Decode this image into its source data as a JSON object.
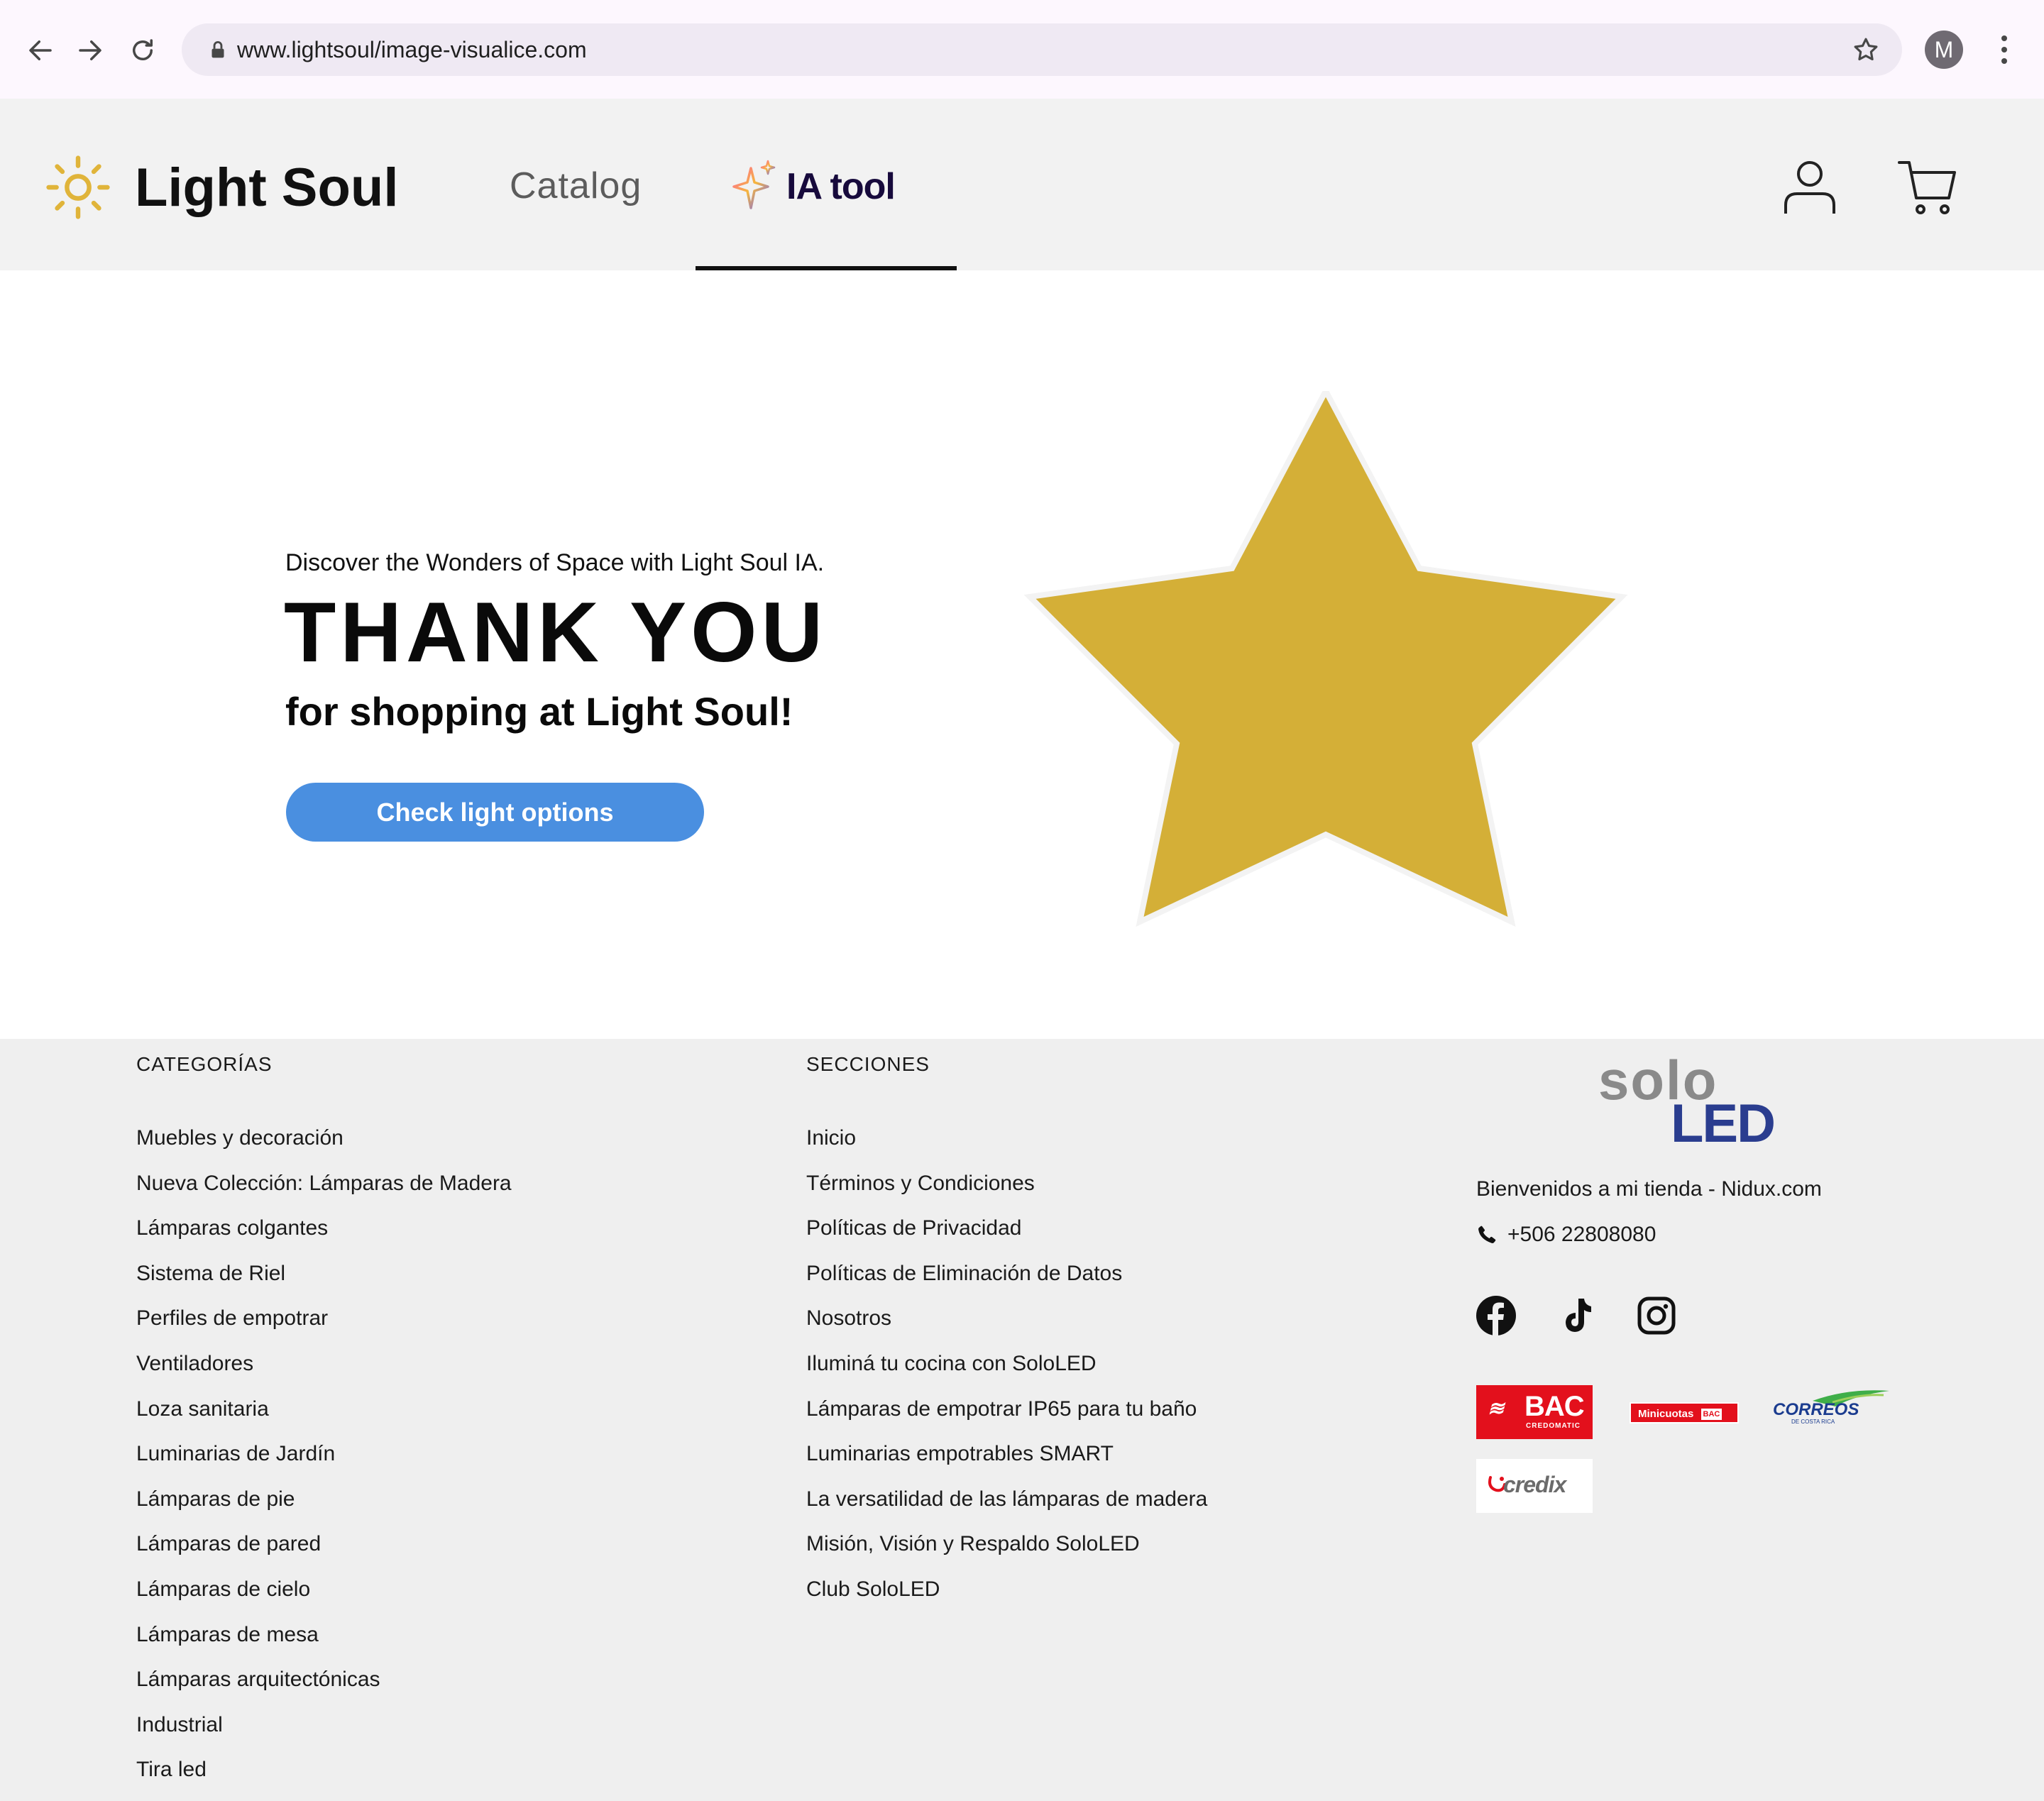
{
  "browser": {
    "url": "www.lightsoul/image-visualice.com",
    "profile_initial": "M"
  },
  "header": {
    "brand": "Light Soul",
    "nav": {
      "catalog": "Catalog",
      "ia_tool": "IA tool",
      "active": "ia_tool"
    }
  },
  "hero": {
    "kicker": "Discover the Wonders of Space with Light Soul IA.",
    "title": "THANK YOU",
    "subtitle": "for shopping at Light Soul!",
    "cta_label": "Check light options",
    "star_color": "#d4af37"
  },
  "footer": {
    "categories": {
      "heading": "CATEGORÍAS",
      "items": [
        "Muebles y decoración",
        "Nueva Colección: Lámparas de Madera",
        "Lámparas colgantes",
        "Sistema de Riel",
        "Perfiles de empotrar",
        "Ventiladores",
        "Loza sanitaria",
        "Luminarias de Jardín",
        "Lámparas de pie",
        "Lámparas de pared",
        "Lámparas de cielo",
        "Lámparas de mesa",
        "Lámparas arquitectónicas",
        "Industrial",
        "Tira led"
      ]
    },
    "sections": {
      "heading": "SECCIONES",
      "items": [
        "Inicio",
        "Términos y Condiciones",
        "Políticas de Privacidad",
        "Políticas de Eliminación de Datos",
        "Nosotros",
        "Iluminá tu cocina con SoloLED",
        "Lámparas de empotrar IP65 para tu baño",
        "Luminarias empotrables SMART",
        "La versatilidad de las lámparas de madera",
        "Misión, Visión y Respaldo SoloLED",
        "Club SoloLED"
      ]
    },
    "store": {
      "logo_top": "solo",
      "logo_bottom": "LED",
      "welcome": "Bienvenidos a mi tienda - Nidux.com",
      "phone": "+506 22808080",
      "social": [
        "facebook-icon",
        "tiktok-icon",
        "instagram-icon"
      ],
      "payments": {
        "bac": "BAC",
        "bac_sub": "CREDOMATIC",
        "minicuotas": "Minicuotas",
        "minicuotas_badge": "BAC",
        "correos": "CORREOS",
        "correos_sub": "DE COSTA RICA",
        "credix": "credix"
      }
    }
  },
  "colors": {
    "accent_blue": "#4a8fe0",
    "brand_gold": "#d4af37",
    "bac_red": "#e3101c",
    "led_blue": "#2a3d8f"
  }
}
